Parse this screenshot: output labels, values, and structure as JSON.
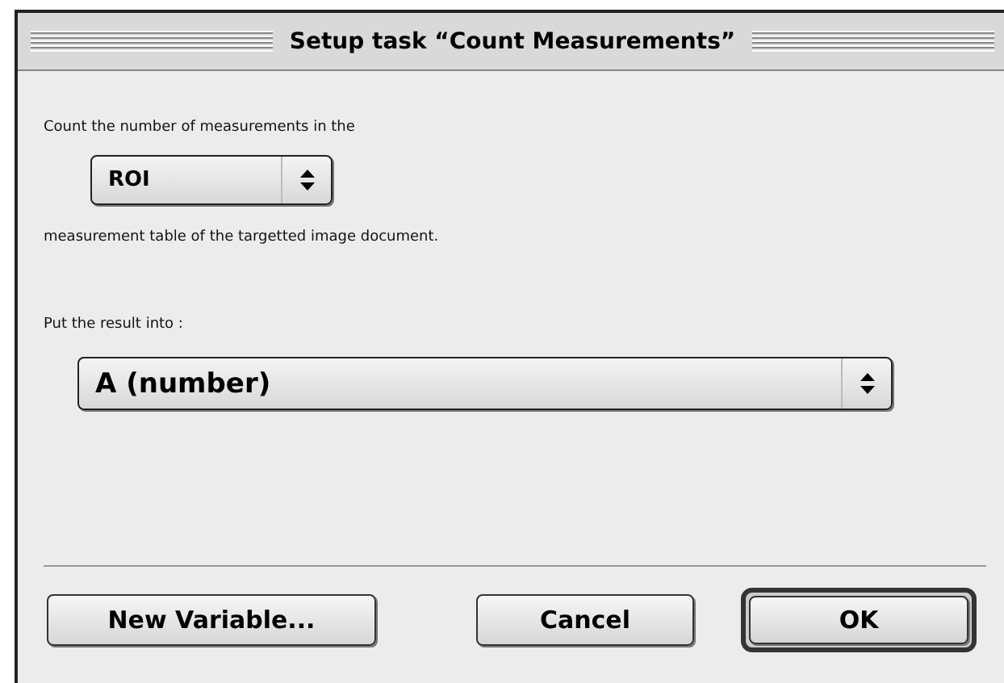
{
  "window": {
    "title": "Setup task “Count Measurements”"
  },
  "intro_text": "Count the number of measurements in the",
  "table_popup": {
    "value": "ROI"
  },
  "after_text": "measurement table of the targetted image document.",
  "result_label": "Put the result into :",
  "result_popup": {
    "value": "A (number)"
  },
  "buttons": [
    {
      "label": "New Variable...",
      "default": false
    },
    {
      "label": "Cancel",
      "default": false
    },
    {
      "label": "OK",
      "default": true
    }
  ]
}
